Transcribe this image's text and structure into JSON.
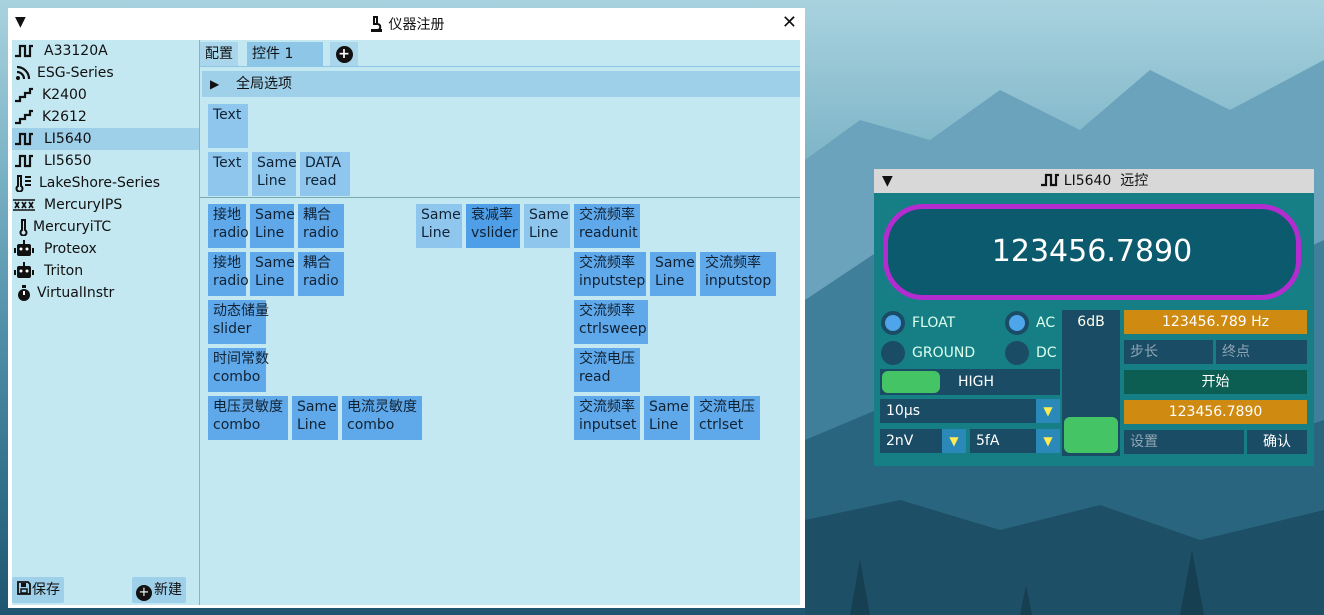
{
  "window": {
    "title": "仪器注册"
  },
  "sidebar": {
    "items": [
      {
        "label": "A33120A",
        "icon": "square-wave-icon"
      },
      {
        "label": "ESG-Series",
        "icon": "signal-icon"
      },
      {
        "label": "K2400",
        "icon": "step-wave-icon"
      },
      {
        "label": "K2612",
        "icon": "step-wave-icon"
      },
      {
        "label": "LI5640",
        "icon": "square-wave-icon"
      },
      {
        "label": "LI5650",
        "icon": "square-wave-icon"
      },
      {
        "label": "LakeShore-Series",
        "icon": "thermometer-icon"
      },
      {
        "label": "MercuryIPS",
        "icon": "coil-icon"
      },
      {
        "label": "MercuryiTC",
        "icon": "thermometer-icon"
      },
      {
        "label": "Proteox",
        "icon": "robot-icon"
      },
      {
        "label": "Triton",
        "icon": "robot-icon"
      },
      {
        "label": "VirtualInstr",
        "icon": "stopwatch-icon"
      }
    ],
    "selected": "LI5640",
    "save_label": "保存",
    "new_label": "新建"
  },
  "tabs": [
    {
      "label": "配置"
    },
    {
      "label": "控件 1"
    }
  ],
  "global_options": "全局选项",
  "widgets": {
    "top1": "Text",
    "r2a": "Text",
    "r2b": "Same\nLine",
    "r2c": "DATA\nread",
    "a1": "接地\nradio",
    "a2": "Same\nLine",
    "a3": "耦合\nradio",
    "a4": "Same\nLine",
    "a5": "衰减率\nvslider",
    "a6": "Same\nLine",
    "a7": "交流频率\nreadunit",
    "b1": "接地\nradio",
    "b2": "Same\nLine",
    "b3": "耦合\nradio",
    "b4": "交流频率\ninputstep",
    "b5": "Same\nLine",
    "b6": "交流频率\ninputstop",
    "c1": "动态储量\nslider",
    "c2": "交流频率\nctrlsweep",
    "d1": "时间常数\ncombo",
    "d2": "交流电压\nread",
    "e1": "电压灵敏度\ncombo",
    "e2": "Same\nLine",
    "e3": "电流灵敏度\ncombo",
    "e4": "交流频率\ninputset",
    "e5": "Same\nLine",
    "e6": "交流电压\nctrlset"
  },
  "remote": {
    "title": "LI5640  远控",
    "display_value": "123456.7890",
    "float": "FLOAT",
    "ground": "GROUND",
    "ac": "AC",
    "dc": "DC",
    "attenuation": "6dB",
    "high": "HIGH",
    "freq_value": "123456.789 Hz",
    "step_placeholder": "步长",
    "end_placeholder": "终点",
    "start": "开始",
    "voltage_value": "123456.7890",
    "set_placeholder": "设置",
    "confirm": "确认",
    "time_constant": "10μs",
    "volt_sens": "2nV",
    "curr_sens": "5fA"
  }
}
